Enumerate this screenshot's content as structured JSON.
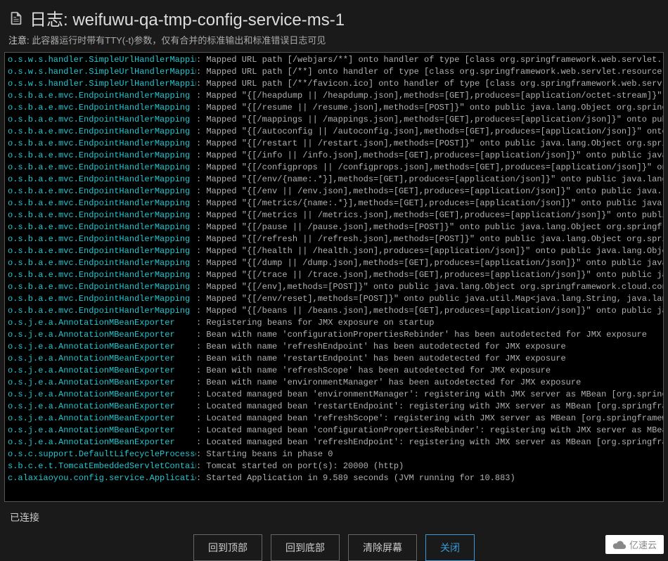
{
  "header": {
    "title": "日志: weifuwu-qa-tmp-config-service-ms-1",
    "notice_label": "注意:",
    "notice_text": "此容器运行时带有TTY(-t)参数，仅有合并的标准输出和标准错误日志可见"
  },
  "status": {
    "connected": "已连接"
  },
  "buttons": {
    "top": "回到顶部",
    "bottom": "回到底部",
    "clear": "清除屏幕",
    "close": "关闭"
  },
  "watermark": "亿速云",
  "log_lines": [
    {
      "src": "o.s.w.s.handler.SimpleUrlHandlerMapping ",
      "msg": ": Mapped URL path [/webjars/**] onto handler of type [class org.springframework.web.servlet.resource"
    },
    {
      "src": "o.s.w.s.handler.SimpleUrlHandlerMapping ",
      "msg": ": Mapped URL path [/**] onto handler of type [class org.springframework.web.servlet.resource.Resource"
    },
    {
      "src": "o.s.w.s.handler.SimpleUrlHandlerMapping ",
      "msg": ": Mapped URL path [/**/favicon.ico] onto handler of type [class org.springframework.web.servlet.reso"
    },
    {
      "src": "o.s.b.a.e.mvc.EndpointHandlerMapping    ",
      "msg": ": Mapped \"{[/heapdump || /heapdump.json],methods=[GET],produces=[application/octet-stream]}\" onto pub"
    },
    {
      "src": "o.s.b.a.e.mvc.EndpointHandlerMapping    ",
      "msg": ": Mapped \"{[/resume || /resume.json],methods=[POST]}\" onto public java.lang.Object org.springframewor"
    },
    {
      "src": "o.s.b.a.e.mvc.EndpointHandlerMapping    ",
      "msg": ": Mapped \"{[/mappings || /mappings.json],methods=[GET],produces=[application/json]}\" onto public java"
    },
    {
      "src": "o.s.b.a.e.mvc.EndpointHandlerMapping    ",
      "msg": ": Mapped \"{[/autoconfig || /autoconfig.json],methods=[GET],produces=[application/json]}\" onto public "
    },
    {
      "src": "o.s.b.a.e.mvc.EndpointHandlerMapping    ",
      "msg": ": Mapped \"{[/restart || /restart.json],methods=[POST]}\" onto public java.lang.Object org.springframew"
    },
    {
      "src": "o.s.b.a.e.mvc.EndpointHandlerMapping    ",
      "msg": ": Mapped \"{[/info || /info.json],methods=[GET],produces=[application/json]}\" onto public java.lang.Ob"
    },
    {
      "src": "o.s.b.a.e.mvc.EndpointHandlerMapping    ",
      "msg": ": Mapped \"{[/configprops || /configprops.json],methods=[GET],produces=[application/json]}\" onto publi"
    },
    {
      "src": "o.s.b.a.e.mvc.EndpointHandlerMapping    ",
      "msg": ": Mapped \"{[/env/{name:.*}],methods=[GET],produces=[application/json]}\" onto public java.lang.Object "
    },
    {
      "src": "o.s.b.a.e.mvc.EndpointHandlerMapping    ",
      "msg": ": Mapped \"{[/env || /env.json],methods=[GET],produces=[application/json]}\" onto public java.lang.Obje"
    },
    {
      "src": "o.s.b.a.e.mvc.EndpointHandlerMapping    ",
      "msg": ": Mapped \"{[/metrics/{name:.*}],methods=[GET],produces=[application/json]}\" onto public java.lang.Obj"
    },
    {
      "src": "o.s.b.a.e.mvc.EndpointHandlerMapping    ",
      "msg": ": Mapped \"{[/metrics || /metrics.json],methods=[GET],produces=[application/json]}\" onto public java.l"
    },
    {
      "src": "o.s.b.a.e.mvc.EndpointHandlerMapping    ",
      "msg": ": Mapped \"{[/pause || /pause.json],methods=[POST]}\" onto public java.lang.Object org.springframework."
    },
    {
      "src": "o.s.b.a.e.mvc.EndpointHandlerMapping    ",
      "msg": ": Mapped \"{[/refresh || /refresh.json],methods=[POST]}\" onto public java.lang.Object org.springframew"
    },
    {
      "src": "o.s.b.a.e.mvc.EndpointHandlerMapping    ",
      "msg": ": Mapped \"{[/health || /health.json],produces=[application/json]}\" onto public java.lang.Object org.s"
    },
    {
      "src": "o.s.b.a.e.mvc.EndpointHandlerMapping    ",
      "msg": ": Mapped \"{[/dump || /dump.json],methods=[GET],produces=[application/json]}\" onto public java.lang.Ob"
    },
    {
      "src": "o.s.b.a.e.mvc.EndpointHandlerMapping    ",
      "msg": ": Mapped \"{[/trace || /trace.json],methods=[GET],produces=[application/json]}\" onto public java.lang."
    },
    {
      "src": "o.s.b.a.e.mvc.EndpointHandlerMapping    ",
      "msg": ": Mapped \"{[/env],methods=[POST]}\" onto public java.lang.Object org.springframework.cloud.context.env"
    },
    {
      "src": "o.s.b.a.e.mvc.EndpointHandlerMapping    ",
      "msg": ": Mapped \"{[/env/reset],methods=[POST]}\" onto public java.util.Map<java.lang.String, java.lang.Object"
    },
    {
      "src": "o.s.b.a.e.mvc.EndpointHandlerMapping    ",
      "msg": ": Mapped \"{[/beans || /beans.json],methods=[GET],produces=[application/json]}\" onto public java.lang."
    },
    {
      "src": "o.s.j.e.a.AnnotationMBeanExporter       ",
      "msg": ": Registering beans for JMX exposure on startup"
    },
    {
      "src": "o.s.j.e.a.AnnotationMBeanExporter       ",
      "msg": ": Bean with name 'configurationPropertiesRebinder' has been autodetected for JMX exposure"
    },
    {
      "src": "o.s.j.e.a.AnnotationMBeanExporter       ",
      "msg": ": Bean with name 'refreshEndpoint' has been autodetected for JMX exposure"
    },
    {
      "src": "o.s.j.e.a.AnnotationMBeanExporter       ",
      "msg": ": Bean with name 'restartEndpoint' has been autodetected for JMX exposure"
    },
    {
      "src": "o.s.j.e.a.AnnotationMBeanExporter       ",
      "msg": ": Bean with name 'refreshScope' has been autodetected for JMX exposure"
    },
    {
      "src": "o.s.j.e.a.AnnotationMBeanExporter       ",
      "msg": ": Bean with name 'environmentManager' has been autodetected for JMX exposure"
    },
    {
      "src": "o.s.j.e.a.AnnotationMBeanExporter       ",
      "msg": ": Located managed bean 'environmentManager': registering with JMX server as MBean [org.springframewor"
    },
    {
      "src": "o.s.j.e.a.AnnotationMBeanExporter       ",
      "msg": ": Located managed bean 'restartEndpoint': registering with JMX server as MBean [org.springframework.c"
    },
    {
      "src": "o.s.j.e.a.AnnotationMBeanExporter       ",
      "msg": ": Located managed bean 'refreshScope': registering with JMX server as MBean [org.springframework.clou"
    },
    {
      "src": "o.s.j.e.a.AnnotationMBeanExporter       ",
      "msg": ": Located managed bean 'configurationPropertiesRebinder': registering with JMX server as MBean [org.s"
    },
    {
      "src": "o.s.j.e.a.AnnotationMBeanExporter       ",
      "msg": ": Located managed bean 'refreshEndpoint': registering with JMX server as MBean [org.springframework.c"
    },
    {
      "src": "o.s.c.support.DefaultLifecycleProcessor ",
      "msg": ": Starting beans in phase 0"
    },
    {
      "src": "s.b.c.e.t.TomcatEmbeddedServletContainer",
      "msg": ": Tomcat started on port(s): 20000 (http)"
    },
    {
      "src": "c.alaxiaoyou.config.service.Application ",
      "msg": ": Started Application in 9.589 seconds (JVM running for 10.883)"
    }
  ]
}
